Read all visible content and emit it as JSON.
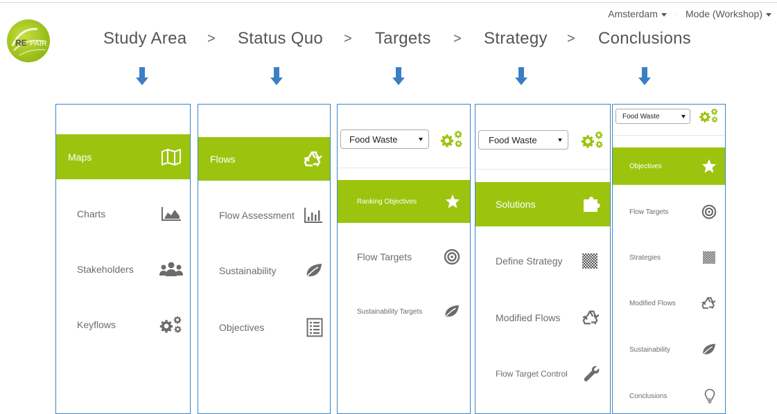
{
  "header": {
    "city": "Amsterdam",
    "mode": "Mode (Workshop)",
    "steps": [
      "Study Area",
      "Status Quo",
      "Targets",
      "Strategy",
      "Conclusions"
    ],
    "separator": ">"
  },
  "colors": {
    "accent": "#9cc40f",
    "panel_border": "#3b83c5",
    "arrow": "#3a7fc4",
    "text_muted": "#6c6c6c"
  },
  "panels": {
    "study_area": {
      "items": [
        {
          "label": "Maps",
          "icon": "map-icon",
          "active": true
        },
        {
          "label": "Charts",
          "icon": "area-chart-icon"
        },
        {
          "label": "Stakeholders",
          "icon": "users-icon"
        },
        {
          "label": "Keyflows",
          "icon": "gears-icon"
        }
      ]
    },
    "status_quo": {
      "items": [
        {
          "label": "Flows",
          "icon": "recycle-icon",
          "active": true
        },
        {
          "label": "Flow Assessment",
          "icon": "bar-chart-icon"
        },
        {
          "label": "Sustainability",
          "icon": "leaf-icon"
        },
        {
          "label": "Objectives",
          "icon": "list-icon"
        }
      ]
    },
    "targets": {
      "select_value": "Food Waste",
      "items": [
        {
          "label": "Ranking Objectives",
          "icon": "star-icon",
          "active": true
        },
        {
          "label": "Flow Targets",
          "icon": "target-icon"
        },
        {
          "label": "Sustainability Targets",
          "icon": "leaf-icon"
        }
      ]
    },
    "strategy": {
      "select_value": "Food Waste",
      "items": [
        {
          "label": "Solutions",
          "icon": "puzzle-icon",
          "active": true
        },
        {
          "label": "Define Strategy",
          "icon": "checker-icon"
        },
        {
          "label": "Modified Flows",
          "icon": "recycle-icon"
        },
        {
          "label": "Flow Target Control",
          "icon": "wrench-icon"
        }
      ]
    },
    "conclusions": {
      "select_value": "Food Waste",
      "items": [
        {
          "label": "Objectives",
          "icon": "star-icon",
          "active": true
        },
        {
          "label": "Flow Targets",
          "icon": "target-icon"
        },
        {
          "label": "Strategies",
          "icon": "checker-icon"
        },
        {
          "label": "Modified Flows",
          "icon": "recycle-icon"
        },
        {
          "label": "Sustainability",
          "icon": "leaf-icon"
        },
        {
          "label": "Conclusions",
          "icon": "lightbulb-icon"
        }
      ]
    }
  }
}
